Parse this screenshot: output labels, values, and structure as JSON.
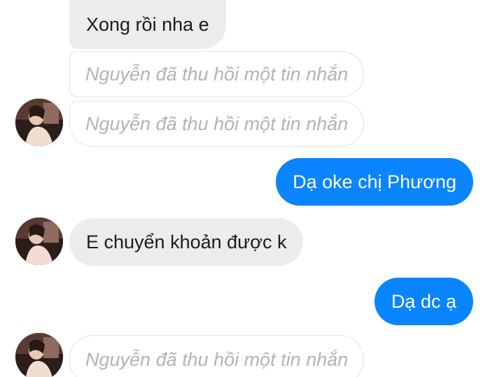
{
  "messages": [
    {
      "text": "Xong rồi nha e"
    },
    {
      "text": "Nguyễn đã thu hồi một tin nhắn"
    },
    {
      "text": "Nguyễn đã thu hồi một tin nhắn"
    },
    {
      "text": "Dạ oke chị Phương"
    },
    {
      "text": "E chuyển khoản được k"
    },
    {
      "text": "Dạ dc ạ"
    },
    {
      "text": "Nguyễn đã thu hồi một tin nhắn"
    }
  ],
  "colors": {
    "outgoing_bubble": "#0a84ff",
    "incoming_bubble": "#ececec",
    "recalled_text": "#b3b3b3"
  }
}
